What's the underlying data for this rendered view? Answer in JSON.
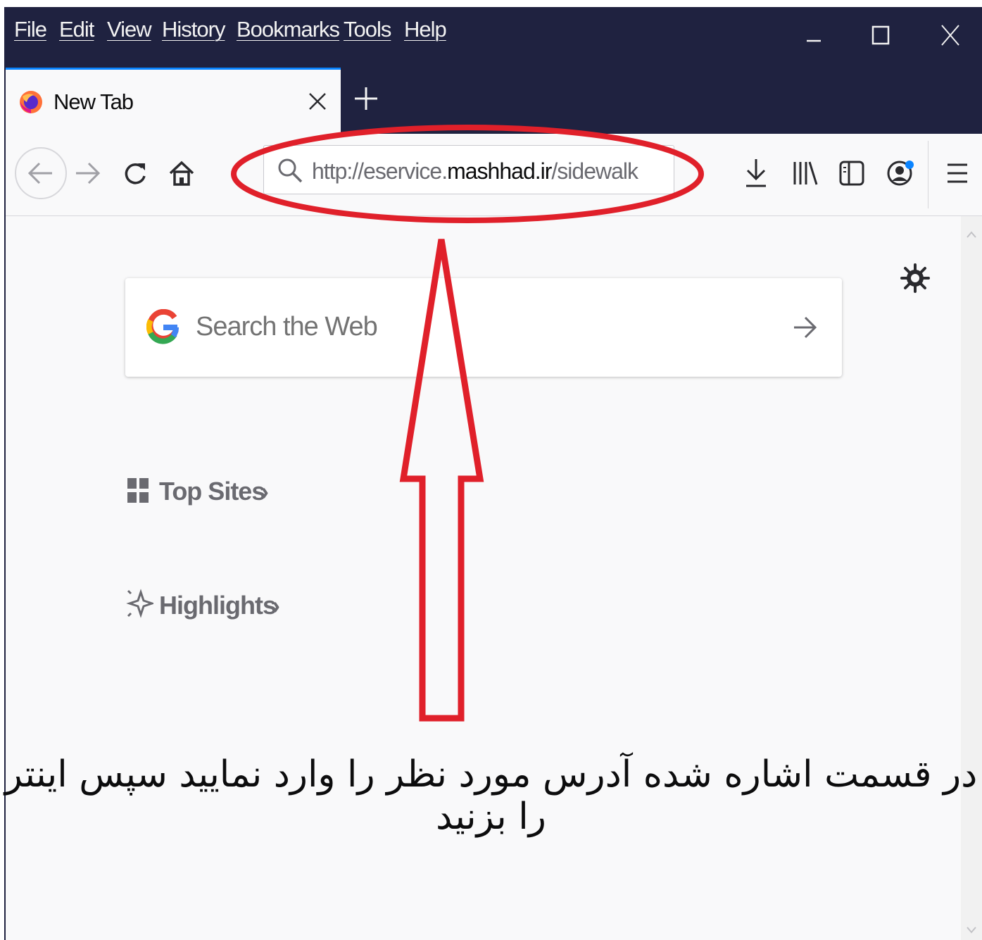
{
  "menu": {
    "items": [
      "File",
      "Edit",
      "View",
      "History",
      "Bookmarks",
      "Tools",
      "Help"
    ]
  },
  "window_controls": {
    "minimize_icon": "minimize-icon",
    "maximize_icon": "maximize-icon",
    "close_icon": "close-icon"
  },
  "tab": {
    "title": "New Tab",
    "close_icon": "close-icon",
    "new_tab_icon": "plus-icon"
  },
  "navbar": {
    "url_prefix": "http://e",
    "url_service": "service.",
    "url_host": "mashhad.ir",
    "url_path": "/sidewalk",
    "icons": [
      "back-arrow-icon",
      "forward-arrow-icon",
      "reload-icon",
      "home-icon",
      "download-icon",
      "library-icon",
      "sidebar-icon",
      "account-icon",
      "hamburger-menu-icon"
    ]
  },
  "newtab": {
    "search_placeholder": "Search the Web",
    "top_sites_label": "Top Sites",
    "highlights_label": "Highlights",
    "chevron": "›"
  },
  "annotation": {
    "instruction": "در قسمت اشاره شده آدرس مورد نظر را وارد نمایید سپس اینتر را بزنید",
    "color": "#e0202a"
  },
  "colors": {
    "titlebar": "#1f2240",
    "accent": "#0a84ff",
    "highlight": "#e0202a"
  }
}
